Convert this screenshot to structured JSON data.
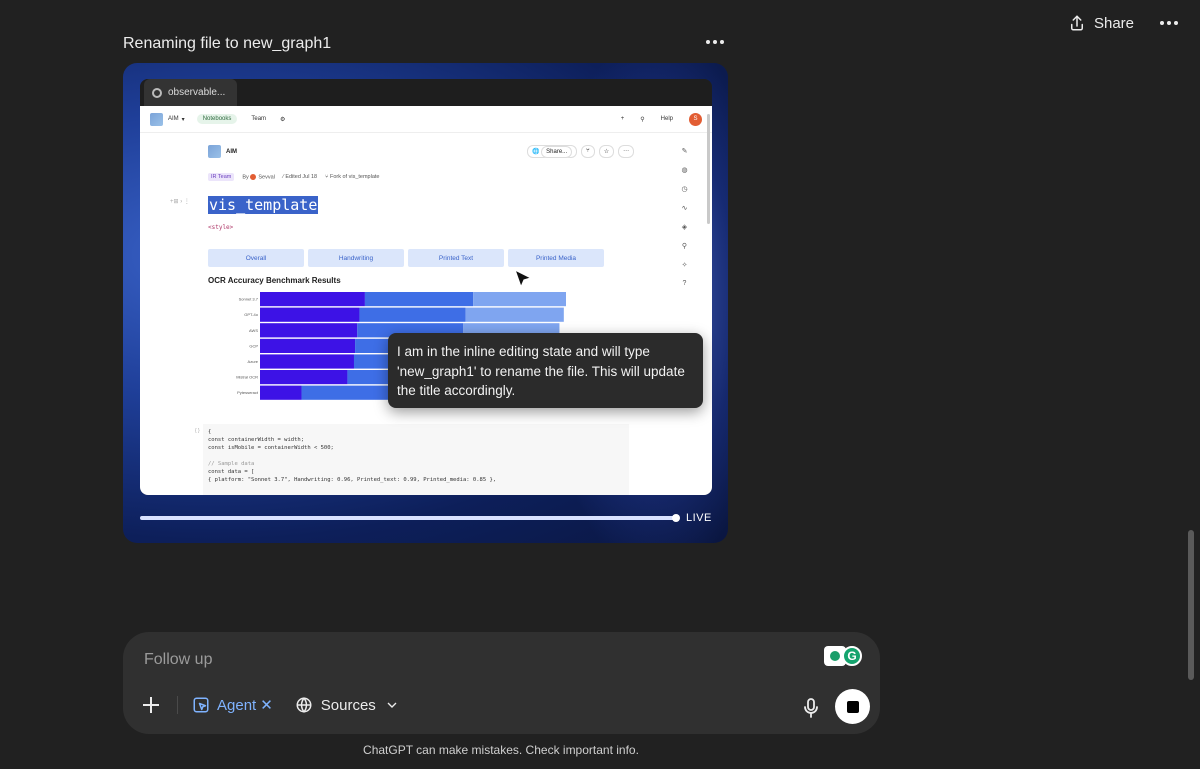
{
  "header": {
    "share_label": "Share"
  },
  "task": {
    "title": "Renaming file to new_graph1"
  },
  "browser": {
    "tab_title": "observable...",
    "app": {
      "brand": "AIM",
      "nav": [
        "Notebooks",
        "Team"
      ],
      "help": "Help",
      "avatar_initial": "S"
    },
    "notebook": {
      "name": "AIM",
      "share_label": "Share...",
      "team": "IR Team",
      "by": "By",
      "author": "Sevval",
      "edited": "Edited Jul 18",
      "fork": "Fork of vis_template",
      "heading": "vis_template",
      "style_tag": "<style>",
      "filters": [
        "Overall",
        "Handwriting",
        "Printed Text",
        "Printed Media"
      ]
    },
    "code_lines": [
      "{",
      "const containerWidth = width;",
      "const isMobile = containerWidth < 500;",
      "",
      "// Sample data",
      "const data = [",
      "  { platform: \"Sonnet 3.7\", Handwriting: 0.96, Printed_text: 0.99, Printed_media: 0.85 },"
    ]
  },
  "chart_data": {
    "type": "bar",
    "title": "OCR Accuracy Benchmark Results",
    "orientation": "horizontal-stacked",
    "categories": [
      "Sonnet 3.7",
      "GPT-4o",
      "AWS",
      "GCP",
      "Azure",
      "Mistral OCR",
      "Pytesseract"
    ],
    "series": [
      {
        "name": "Handwriting",
        "color": "#3d12e6",
        "values": [
          0.96,
          0.91,
          0.89,
          0.87,
          0.86,
          0.8,
          0.38
        ]
      },
      {
        "name": "Printed_text",
        "color": "#3e6ee6",
        "values": [
          0.99,
          0.97,
          0.97,
          0.97,
          0.96,
          0.95,
          0.9
        ]
      },
      {
        "name": "Printed_media",
        "color": "#7fa5f0",
        "values": [
          0.85,
          0.9,
          0.88,
          0.86,
          0.84,
          0.82,
          0.8
        ]
      }
    ]
  },
  "tooltip": {
    "text": "I am in the inline editing state and will type 'new_graph1' to rename the file. This will update the title accordingly."
  },
  "live_label": "LIVE",
  "composer": {
    "placeholder": "Follow up",
    "agent_label": "Agent",
    "sources_label": "Sources"
  },
  "disclaimer": "ChatGPT can make mistakes. Check important info.",
  "colors": {
    "accent": "#7fb3ff",
    "background": "#212121",
    "composer": "#303030"
  }
}
